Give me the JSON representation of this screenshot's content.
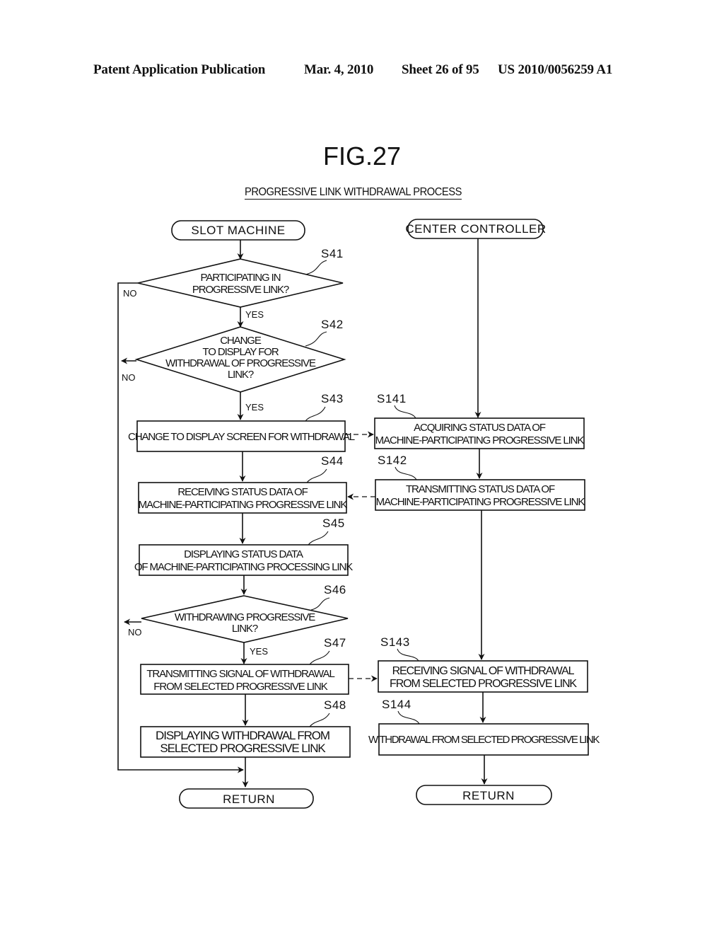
{
  "header": {
    "publication": "Patent Application Publication",
    "date": "Mar. 4, 2010",
    "sheet": "Sheet 26 of 95",
    "number": "US 2010/0056259 A1"
  },
  "figure": {
    "title": "FIG.27",
    "subtitle": "PROGRESSIVE LINK WITHDRAWAL PROCESS"
  },
  "flow": {
    "slot_machine": {
      "start": "SLOT MACHINE",
      "s41": {
        "step": "S41",
        "lines": [
          "PARTICIPATING IN",
          "PROGRESSIVE LINK?"
        ],
        "no": "NO",
        "yes": "YES"
      },
      "s42": {
        "step": "S42",
        "lines": [
          "CHANGE",
          "TO DISPLAY FOR",
          "WITHDRAWAL OF PROGRESSIVE",
          "LINK?"
        ],
        "no": "NO",
        "yes": "YES"
      },
      "s43": {
        "step": "S43",
        "lines": [
          "CHANGE TO DISPLAY SCREEN FOR WITHDRAWAL"
        ]
      },
      "s44": {
        "step": "S44",
        "lines": [
          "RECEIVING STATUS DATA OF",
          "MACHINE-PARTICIPATING PROGRESSIVE LINK"
        ]
      },
      "s45": {
        "step": "S45",
        "lines": [
          "DISPLAYING STATUS DATA",
          "OF MACHINE-PARTICIPATING PROCESSING LINK"
        ]
      },
      "s46": {
        "step": "S46",
        "lines": [
          "WITHDRAWING PROGRESSIVE",
          "LINK?"
        ],
        "no": "NO",
        "yes": "YES"
      },
      "s47": {
        "step": "S47",
        "lines": [
          "TRANSMITTING SIGNAL OF WITHDRAWAL",
          "FROM SELECTED PROGRESSIVE LINK"
        ]
      },
      "s48": {
        "step": "S48",
        "lines": [
          "DISPLAYING WITHDRAWAL FROM",
          "SELECTED PROGRESSIVE LINK"
        ]
      },
      "end": "RETURN"
    },
    "center_controller": {
      "start": "CENTER CONTROLLER",
      "s141": {
        "step": "S141",
        "lines": [
          "ACQUIRING STATUS DATA OF",
          "MACHINE-PARTICIPATING PROGRESSIVE LINK"
        ]
      },
      "s142": {
        "step": "S142",
        "lines": [
          "TRANSMITTING STATUS DATA OF",
          "MACHINE-PARTICIPATING PROGRESSIVE LINK"
        ]
      },
      "s143": {
        "step": "S143",
        "lines": [
          "RECEIVING SIGNAL OF WITHDRAWAL",
          "FROM SELECTED PROGRESSIVE LINK"
        ]
      },
      "s144": {
        "step": "S144",
        "lines": [
          "WITHDRAWAL FROM SELECTED PROGRESSIVE LINK"
        ]
      },
      "end": "RETURN"
    }
  }
}
